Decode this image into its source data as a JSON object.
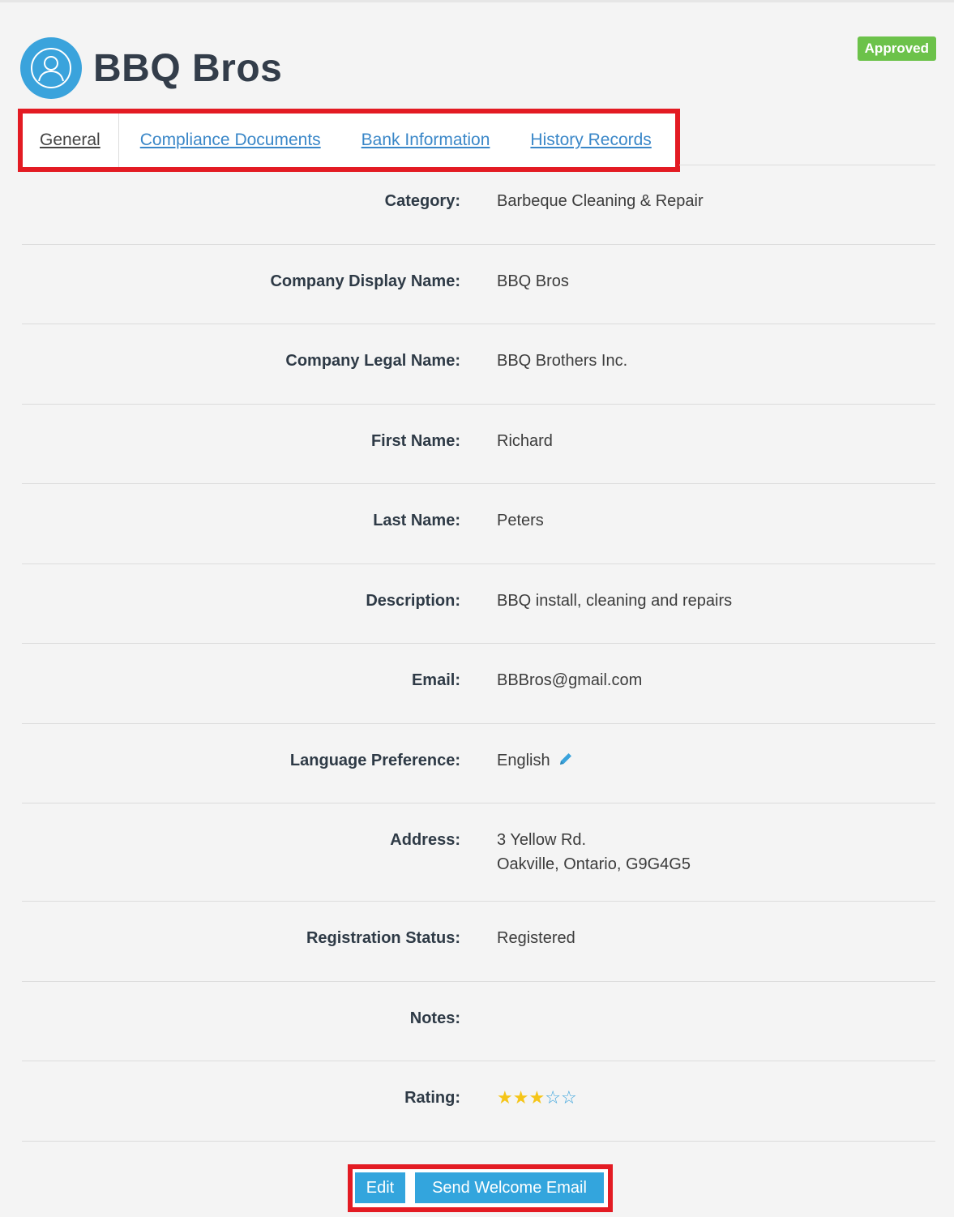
{
  "header": {
    "title": "BBQ Bros",
    "status": "Approved",
    "avatar_icon": "user-icon",
    "accent_color": "#3aa3dc",
    "status_color": "#6cc24a"
  },
  "tabs": [
    {
      "label": "General",
      "active": true
    },
    {
      "label": "Compliance Documents",
      "active": false
    },
    {
      "label": "Bank Information",
      "active": false
    },
    {
      "label": "History Records",
      "active": false
    }
  ],
  "fields": {
    "category": {
      "label": "Category:",
      "value": "Barbeque Cleaning & Repair"
    },
    "display_name": {
      "label": "Company Display Name:",
      "value": "BBQ Bros"
    },
    "legal_name": {
      "label": "Company Legal Name:",
      "value": "BBQ Brothers Inc."
    },
    "first_name": {
      "label": "First Name:",
      "value": "Richard"
    },
    "last_name": {
      "label": "Last Name:",
      "value": "Peters"
    },
    "description": {
      "label": "Description:",
      "value": "BBQ install, cleaning and repairs"
    },
    "email": {
      "label": "Email:",
      "value": "BBBros@gmail.com"
    },
    "language": {
      "label": "Language Preference:",
      "value": "English",
      "edit_icon": "pencil-icon"
    },
    "address": {
      "label": "Address:",
      "line1": "3 Yellow Rd.",
      "line2": "Oakville, Ontario, G9G4G5"
    },
    "registration": {
      "label": "Registration Status:",
      "value": "Registered"
    },
    "notes": {
      "label": "Notes:",
      "value": ""
    },
    "rating": {
      "label": "Rating:",
      "value": 3,
      "max": 5,
      "filled_color": "#f5c518",
      "empty_color": "#3aa3dc"
    }
  },
  "actions": {
    "edit_label": "Edit",
    "welcome_label": "Send Welcome Email"
  }
}
